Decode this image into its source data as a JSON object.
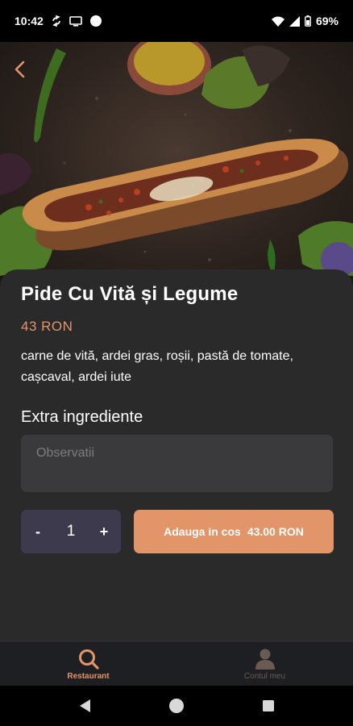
{
  "status_bar": {
    "time": "10:42",
    "battery": "69%",
    "icons": [
      "sync-icon",
      "cast-icon",
      "notification-dot-icon",
      "wifi-icon",
      "signal-icon",
      "battery-icon"
    ]
  },
  "product": {
    "title": "Pide Cu Vită și Legume",
    "price": "43 RON",
    "description": "carne de vită, ardei gras, roșii, pastă de tomate, cașcaval, ardei iute"
  },
  "extras": {
    "label": "Extra ingrediente",
    "notes_placeholder": "Observatii"
  },
  "order": {
    "minus_label": "-",
    "quantity": "1",
    "plus_label": "+",
    "add_label": "Adauga in cos",
    "add_total": "43.00 RON"
  },
  "bottom_nav": {
    "items": [
      {
        "label": "Restaurant",
        "icon": "search-icon",
        "active": true
      },
      {
        "label": "Contul meu",
        "icon": "user-icon",
        "active": false
      }
    ]
  },
  "colors": {
    "accent": "#e3956a",
    "card_bg": "#2a2a2b",
    "input_bg": "#3a3a3c",
    "stepper_bg": "#3e3a4d",
    "nav_bg": "#1e1f22",
    "inactive": "#6b5a52"
  }
}
